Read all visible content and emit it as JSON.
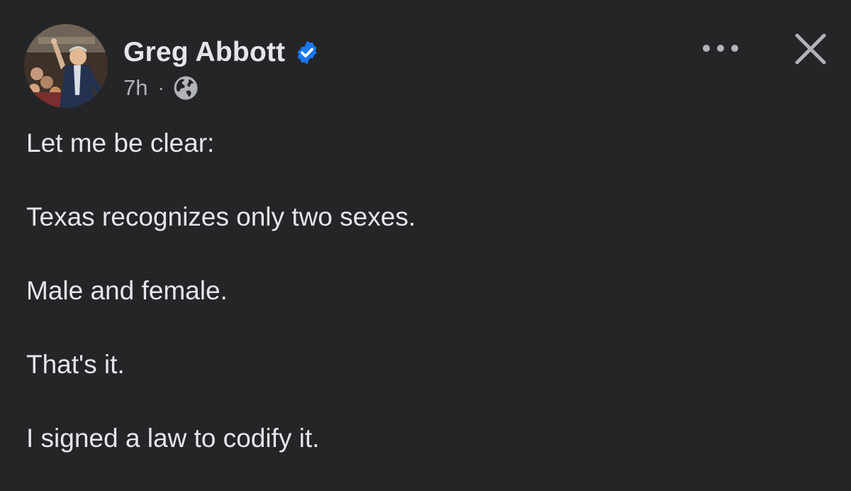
{
  "post": {
    "author": {
      "name": "Greg Abbott",
      "verified": true,
      "avatar_icon": "profile-photo"
    },
    "meta": {
      "timestamp": "7h",
      "separator": "·",
      "audience_icon": "globe-icon"
    },
    "actions": {
      "more_icon": "more-options-icon",
      "close_icon": "close-icon"
    },
    "paragraphs": [
      "Let me be clear:",
      "Texas recognizes only two sexes.",
      "Male and female.",
      "That's it.",
      "I signed a law to codify it."
    ]
  },
  "colors": {
    "background": "#242526",
    "primary_text": "#e4e6eb",
    "secondary_text": "#b0b3b8",
    "verified_badge": "#1877f2"
  }
}
